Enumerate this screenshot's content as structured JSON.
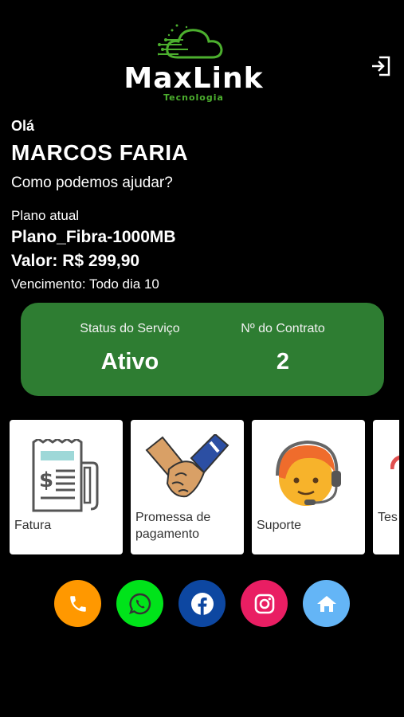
{
  "brand": {
    "name": "MaxLink",
    "tagline": "Tecnologia",
    "accent_color": "#4caf2e"
  },
  "header": {
    "logout_icon": "logout-icon"
  },
  "user": {
    "greeting": "Olá",
    "name": "MARCOS FARIA",
    "help_text": "Como podemos ajudar?"
  },
  "plan": {
    "label": "Plano atual",
    "name": "Plano_Fibra-1000MB",
    "value": "Valor: R$ 299,90",
    "due": "Vencimento: Todo dia 10"
  },
  "status_card": {
    "bg_color": "#2e7d32",
    "service_status_label": "Status do Serviço",
    "service_status_value": "Ativo",
    "contract_label": "Nº do Contrato",
    "contract_value": "2"
  },
  "cards": [
    {
      "label": "Fatura",
      "icon": "invoice-icon"
    },
    {
      "label": "Promessa de pagamento",
      "icon": "handshake-icon"
    },
    {
      "label": "Suporte",
      "icon": "support-agent-icon"
    },
    {
      "label": "Tes velo",
      "icon": "speedtest-icon"
    }
  ],
  "social": [
    {
      "name": "phone",
      "icon": "phone-icon",
      "color": "#ff9800"
    },
    {
      "name": "whatsapp",
      "icon": "whatsapp-icon",
      "color": "#00e31a"
    },
    {
      "name": "facebook",
      "icon": "facebook-icon",
      "color": "#0d47a1"
    },
    {
      "name": "instagram",
      "icon": "instagram-icon",
      "color": "#e91e63"
    },
    {
      "name": "home",
      "icon": "home-icon",
      "color": "#64b5f6"
    }
  ]
}
